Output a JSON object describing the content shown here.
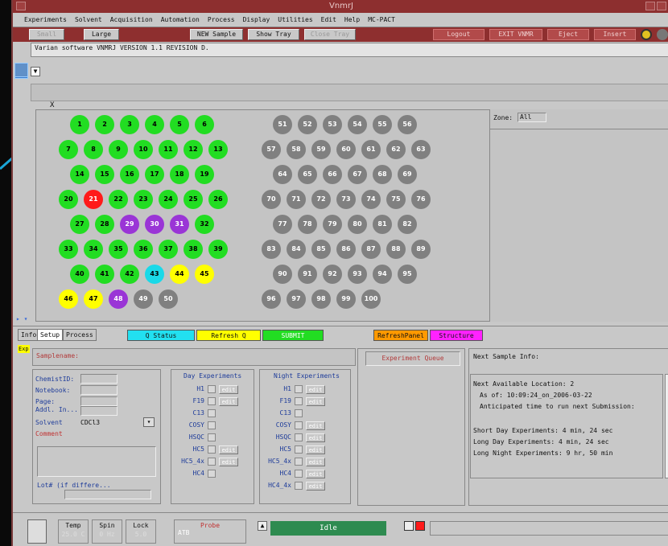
{
  "window": {
    "title": "VnmrJ"
  },
  "menu": [
    "Experiments",
    "Solvent",
    "Acquisition",
    "Automation",
    "Process",
    "Display",
    "Utilities",
    "Edit",
    "Help",
    "MC-PACT"
  ],
  "toolbar": {
    "small": "Small",
    "large": "Large",
    "new_sample": "NEW Sample",
    "show_tray": "Show Tray",
    "close_tray": "Close Tray",
    "logout": "Logout",
    "exit": "EXIT VNMR",
    "eject": "Eject",
    "insert": "Insert"
  },
  "message": "Varian software VNMRJ VERSION 1.1 REVISION D.",
  "x_label": "X",
  "zone": {
    "label": "Zone:",
    "value": "All"
  },
  "wells": [
    {
      "n": "1",
      "s": "g"
    },
    {
      "n": "2",
      "s": "g"
    },
    {
      "n": "3",
      "s": "g"
    },
    {
      "n": "4",
      "s": "g"
    },
    {
      "n": "5",
      "s": "g"
    },
    {
      "n": "6",
      "s": "g"
    },
    {
      "n": "7",
      "s": "g"
    },
    {
      "n": "8",
      "s": "g"
    },
    {
      "n": "9",
      "s": "g"
    },
    {
      "n": "10",
      "s": "g"
    },
    {
      "n": "11",
      "s": "g"
    },
    {
      "n": "12",
      "s": "g"
    },
    {
      "n": "13",
      "s": "g"
    },
    {
      "n": "14",
      "s": "g"
    },
    {
      "n": "15",
      "s": "g"
    },
    {
      "n": "16",
      "s": "g"
    },
    {
      "n": "17",
      "s": "g"
    },
    {
      "n": "18",
      "s": "g"
    },
    {
      "n": "19",
      "s": "g"
    },
    {
      "n": "20",
      "s": "g"
    },
    {
      "n": "21",
      "s": "r"
    },
    {
      "n": "22",
      "s": "g"
    },
    {
      "n": "23",
      "s": "g"
    },
    {
      "n": "24",
      "s": "g"
    },
    {
      "n": "25",
      "s": "g"
    },
    {
      "n": "26",
      "s": "g"
    },
    {
      "n": "27",
      "s": "g"
    },
    {
      "n": "28",
      "s": "g"
    },
    {
      "n": "29",
      "s": "p"
    },
    {
      "n": "30",
      "s": "p"
    },
    {
      "n": "31",
      "s": "p"
    },
    {
      "n": "32",
      "s": "g"
    },
    {
      "n": "33",
      "s": "g"
    },
    {
      "n": "34",
      "s": "g"
    },
    {
      "n": "35",
      "s": "g"
    },
    {
      "n": "36",
      "s": "g"
    },
    {
      "n": "37",
      "s": "g"
    },
    {
      "n": "38",
      "s": "g"
    },
    {
      "n": "39",
      "s": "g"
    },
    {
      "n": "40",
      "s": "g"
    },
    {
      "n": "41",
      "s": "g"
    },
    {
      "n": "42",
      "s": "g"
    },
    {
      "n": "43",
      "s": "c"
    },
    {
      "n": "44",
      "s": "y"
    },
    {
      "n": "45",
      "s": "y"
    },
    {
      "n": "46",
      "s": "y"
    },
    {
      "n": "47",
      "s": "y"
    },
    {
      "n": "48",
      "s": "p"
    },
    {
      "n": "49",
      "s": "gr"
    },
    {
      "n": "50",
      "s": "gr"
    },
    {
      "n": "51",
      "s": "gr"
    },
    {
      "n": "52",
      "s": "gr"
    },
    {
      "n": "53",
      "s": "gr"
    },
    {
      "n": "54",
      "s": "gr"
    },
    {
      "n": "55",
      "s": "gr"
    },
    {
      "n": "56",
      "s": "gr"
    },
    {
      "n": "57",
      "s": "gr"
    },
    {
      "n": "58",
      "s": "gr"
    },
    {
      "n": "59",
      "s": "gr"
    },
    {
      "n": "60",
      "s": "gr"
    },
    {
      "n": "61",
      "s": "gr"
    },
    {
      "n": "62",
      "s": "gr"
    },
    {
      "n": "63",
      "s": "gr"
    },
    {
      "n": "64",
      "s": "gr"
    },
    {
      "n": "65",
      "s": "gr"
    },
    {
      "n": "66",
      "s": "gr"
    },
    {
      "n": "67",
      "s": "gr"
    },
    {
      "n": "68",
      "s": "gr"
    },
    {
      "n": "69",
      "s": "gr"
    },
    {
      "n": "70",
      "s": "gr"
    },
    {
      "n": "71",
      "s": "gr"
    },
    {
      "n": "72",
      "s": "gr"
    },
    {
      "n": "73",
      "s": "gr"
    },
    {
      "n": "74",
      "s": "gr"
    },
    {
      "n": "75",
      "s": "gr"
    },
    {
      "n": "76",
      "s": "gr"
    },
    {
      "n": "77",
      "s": "gr"
    },
    {
      "n": "78",
      "s": "gr"
    },
    {
      "n": "79",
      "s": "gr"
    },
    {
      "n": "80",
      "s": "gr"
    },
    {
      "n": "81",
      "s": "gr"
    },
    {
      "n": "82",
      "s": "gr"
    },
    {
      "n": "83",
      "s": "gr"
    },
    {
      "n": "84",
      "s": "gr"
    },
    {
      "n": "85",
      "s": "gr"
    },
    {
      "n": "86",
      "s": "gr"
    },
    {
      "n": "87",
      "s": "gr"
    },
    {
      "n": "88",
      "s": "gr"
    },
    {
      "n": "89",
      "s": "gr"
    },
    {
      "n": "90",
      "s": "gr"
    },
    {
      "n": "91",
      "s": "gr"
    },
    {
      "n": "92",
      "s": "gr"
    },
    {
      "n": "93",
      "s": "gr"
    },
    {
      "n": "94",
      "s": "gr"
    },
    {
      "n": "95",
      "s": "gr"
    },
    {
      "n": "96",
      "s": "gr"
    },
    {
      "n": "97",
      "s": "gr"
    },
    {
      "n": "98",
      "s": "gr"
    },
    {
      "n": "99",
      "s": "gr"
    },
    {
      "n": "100",
      "s": "gr"
    }
  ],
  "tabs": {
    "info": "Info",
    "setup": "Setup",
    "process": "Process"
  },
  "qbuttons": {
    "qstatus": "Q Status",
    "refreshq": "Refresh Q",
    "submit": "SUBMIT",
    "refreshpanel": "RefreshPanel",
    "structure": "Structure"
  },
  "form": {
    "exp": "Exp",
    "samplename": "Samplename:",
    "chemist": "ChemistID:",
    "notebook": "Notebook:",
    "page": "Page:",
    "addl": "Addl. In...",
    "solvent_label": "Solvent",
    "solvent_value": "CDCl3",
    "comment": "Comment",
    "lot": "Lot# (if differe..."
  },
  "day": {
    "title": "Day Experiments",
    "items": [
      "H1",
      "F19",
      "C13",
      "COSY",
      "HSQC",
      "HC5",
      "HC5_4x",
      "HC4"
    ]
  },
  "night": {
    "title": "Night Experiments",
    "items": [
      "H1",
      "F19",
      "C13",
      "COSY",
      "HSQC",
      "HC5",
      "HC5_4x",
      "HC4",
      "HC4_4x"
    ]
  },
  "edit_label": "edit",
  "queue_title": "Experiment Queue",
  "next": {
    "title": "Next Sample Info:",
    "loc": "Next Available Location:  2",
    "asof": "As of: 10:09:24_on_2006-03-22",
    "antic": "Anticipated time to run next Submission:",
    "short_day": "Short Day Experiments: 4 min, 24 sec",
    "long_day": "Long Day Experiments: 4 min, 24 sec",
    "long_night": "Long Night Experiments: 9 hr, 50 min"
  },
  "status": {
    "temp": "Temp",
    "temp_val": "25.0 C",
    "spin": "Spin",
    "spin_val": "0 Hz",
    "lock": "Lock",
    "lock_val": "5.0",
    "probe": "Probe",
    "probe_val": "ATB",
    "idle": "Idle"
  }
}
